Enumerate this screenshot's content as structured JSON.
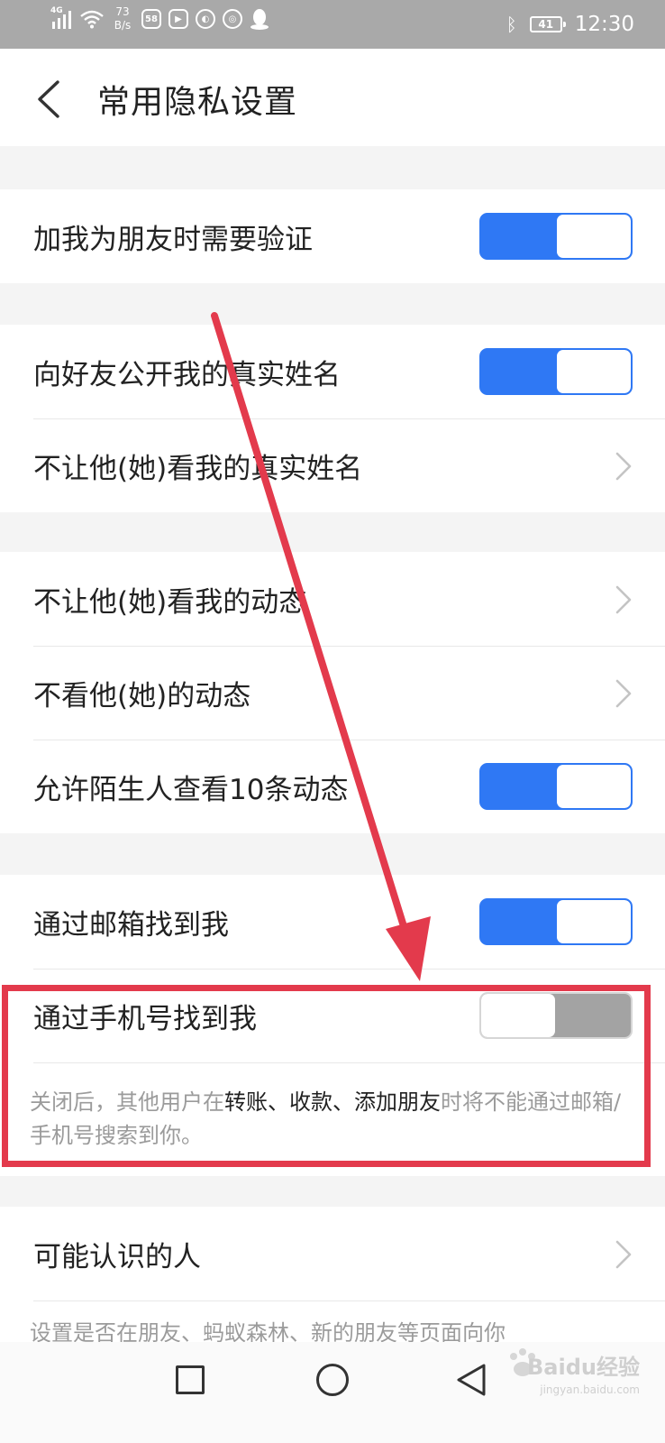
{
  "status_bar": {
    "network": "4G",
    "speed_value": "73",
    "speed_unit": "B/s",
    "app_badge": "58",
    "battery": "41",
    "time": "12:30"
  },
  "header": {
    "title": "常用隐私设置"
  },
  "sections": {
    "verify": {
      "items": [
        {
          "label": "加我为朋友时需要验证",
          "control": "toggle",
          "state": "on"
        }
      ]
    },
    "real_name": {
      "items": [
        {
          "label": "向好友公开我的真实姓名",
          "control": "toggle",
          "state": "on"
        },
        {
          "label": "不让他(她)看我的真实姓名",
          "control": "chevron"
        }
      ]
    },
    "moments": {
      "items": [
        {
          "label": "不让他(她)看我的动态",
          "control": "chevron"
        },
        {
          "label": "不看他(她)的动态",
          "control": "chevron"
        },
        {
          "label": "允许陌生人查看10条动态",
          "control": "toggle",
          "state": "on"
        }
      ]
    },
    "find_me": {
      "items": [
        {
          "label": "通过邮箱找到我",
          "control": "toggle",
          "state": "on"
        },
        {
          "label": "通过手机号找到我",
          "control": "toggle",
          "state": "off"
        }
      ],
      "note": {
        "part1": "关闭后，其他用户在",
        "highlight": "转账、收款、添加朋友",
        "part2": "时将不能通过邮箱/手机号搜索到你。"
      }
    },
    "people": {
      "items": [
        {
          "label": "可能认识的人",
          "control": "chevron"
        }
      ],
      "note": "设置是否在朋友、蚂蚁森林、新的朋友等页面向你"
    }
  },
  "watermark": {
    "brand": "Baidu经验",
    "url": "jingyan.baidu.com"
  },
  "colors": {
    "toggle_on": "#2f78f4",
    "toggle_off": "#a3a3a3",
    "annotation_red": "#e33a4c",
    "status_bar_bg": "#a9a9a9"
  }
}
